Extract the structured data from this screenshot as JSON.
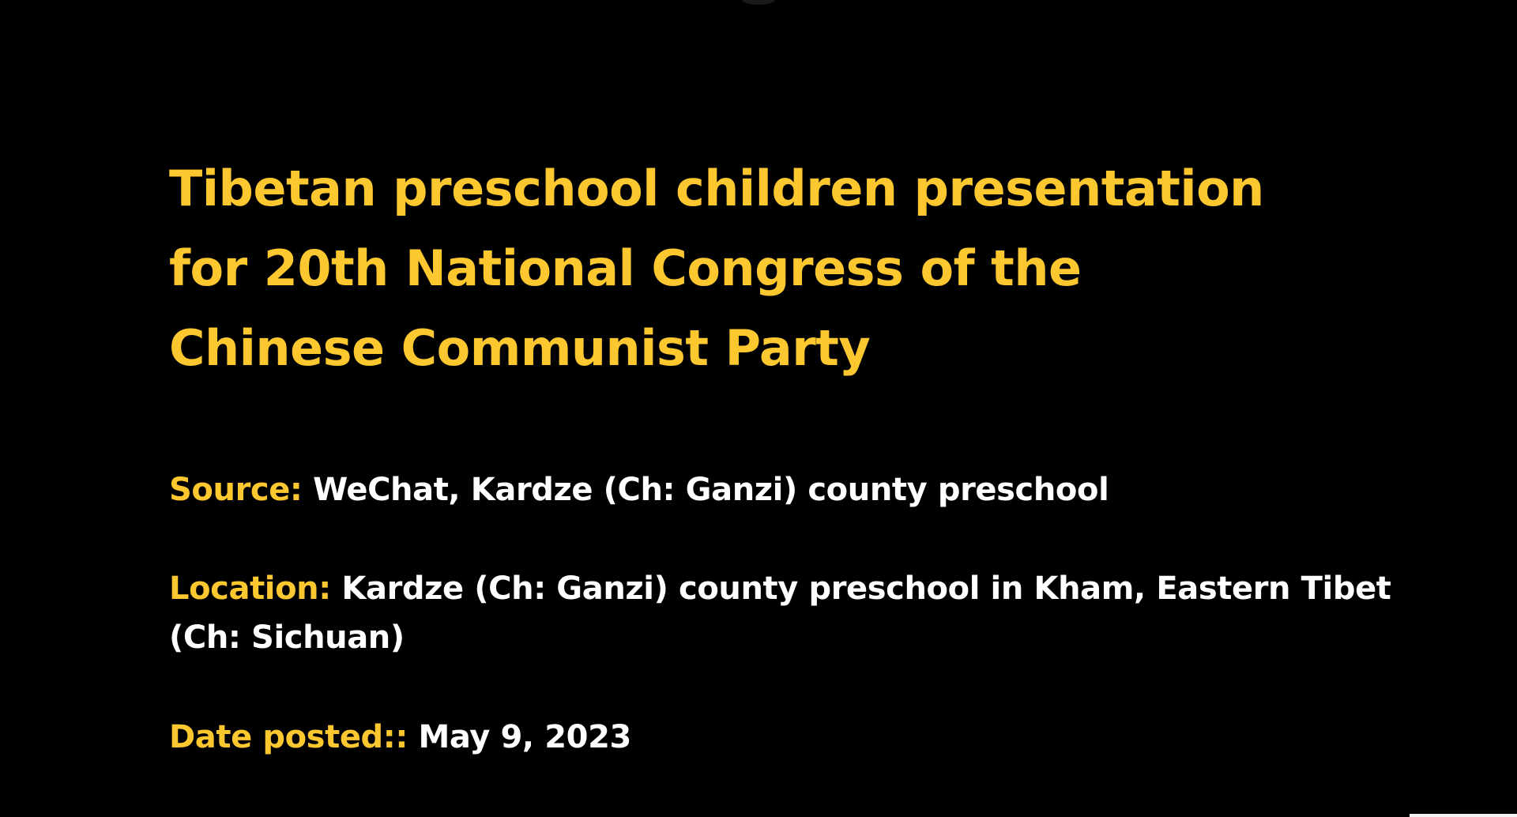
{
  "colors": {
    "background": "#000000",
    "accent": "#FDC82F",
    "text": "#FFFFFF"
  },
  "title": {
    "lines": [
      "Tibetan preschool children presentation",
      "for 20th National Congress of the",
      "Chinese Communist Party"
    ]
  },
  "details": {
    "source": {
      "label": "Source:",
      "value": "WeChat, Kardze (Ch: Ganzi) county preschool"
    },
    "location": {
      "label": "Location:",
      "value_line1": "Kardze (Ch: Ganzi) county preschool in Kham, Eastern Tibet",
      "value_line2": "(Ch: Sichuan)"
    },
    "date": {
      "label": "Date posted::",
      "value": "May 9, 2023"
    }
  }
}
